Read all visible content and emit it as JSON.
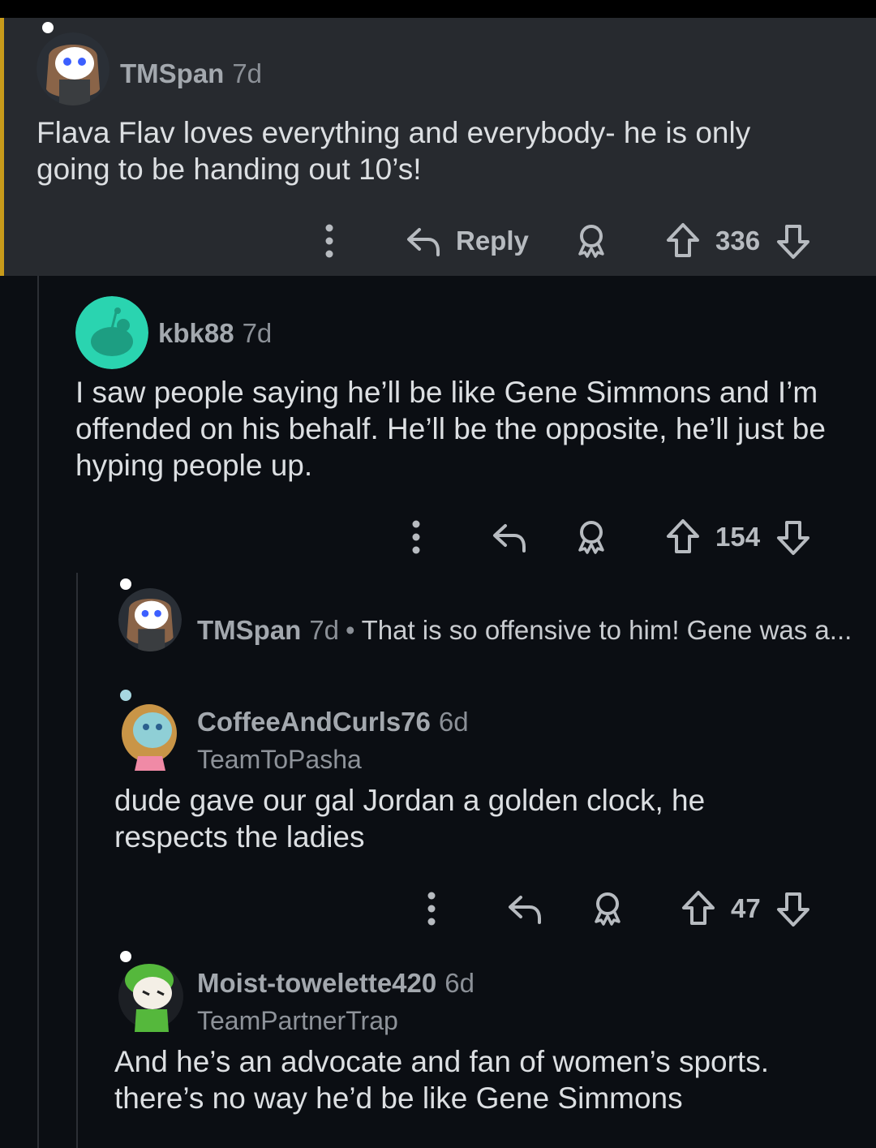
{
  "comments": [
    {
      "username": "TMSpan",
      "age": "7d",
      "body": "Flava Flav loves everything and everybody- he is only going to be handing out 10’s!",
      "reply_label": "Reply",
      "votes": "336"
    },
    {
      "username": "kbk88",
      "age": "7d",
      "body": "I saw people saying he’ll be like Gene Simmons and I’m offended on his behalf. He’ll be the opposite, he’ll just be hyping people up.",
      "votes": "154"
    },
    {
      "username": "TMSpan",
      "age": "7d",
      "separator": "•",
      "collapsed_text": "That is so offensive to him! Gene was a..."
    },
    {
      "username": "CoffeeAndCurls76",
      "age": "6d",
      "flair": "TeamToPasha",
      "body": "dude gave our gal Jordan a golden clock, he respects the ladies",
      "votes": "47"
    },
    {
      "username": "Moist-towelette420",
      "age": "6d",
      "flair": "TeamPartnerTrap",
      "body": "And he’s an advocate and fan of women’s sports. there’s no way he’d be like Gene Simmons"
    }
  ],
  "colors": {
    "highlight_bg": "#272a2f",
    "highlight_border": "#c79a1a",
    "page_bg": "#0b0e13",
    "avatar_teal": "#2ad4b0"
  }
}
